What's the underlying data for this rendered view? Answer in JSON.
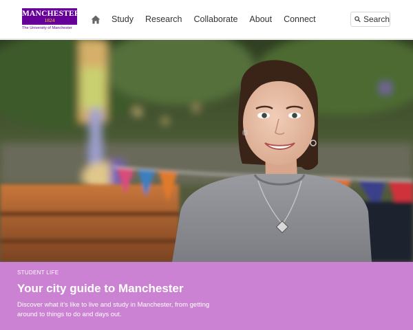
{
  "header": {
    "logo": {
      "wordmark": "MANCHESTER",
      "year": "1824",
      "subtitle": "The University of Manchester"
    },
    "nav": {
      "home_icon": "home-icon",
      "items": [
        {
          "label": "Study"
        },
        {
          "label": "Research"
        },
        {
          "label": "Collaborate"
        },
        {
          "label": "About"
        },
        {
          "label": "Connect"
        }
      ]
    },
    "search": {
      "icon": "search-icon",
      "label": "Search"
    }
  },
  "hero": {
    "image": "photo-of-smiling-student-on-canal-boat"
  },
  "promo": {
    "eyebrow": "STUDENT LIFE",
    "title": "Your city guide to Manchester",
    "description": "Discover what it’s like to live and study in Manchester, from getting around to things to do and days out."
  },
  "colors": {
    "brand_purple": "#660099",
    "brand_gold": "#ffcc33",
    "promo_background": "#cc82d2"
  }
}
